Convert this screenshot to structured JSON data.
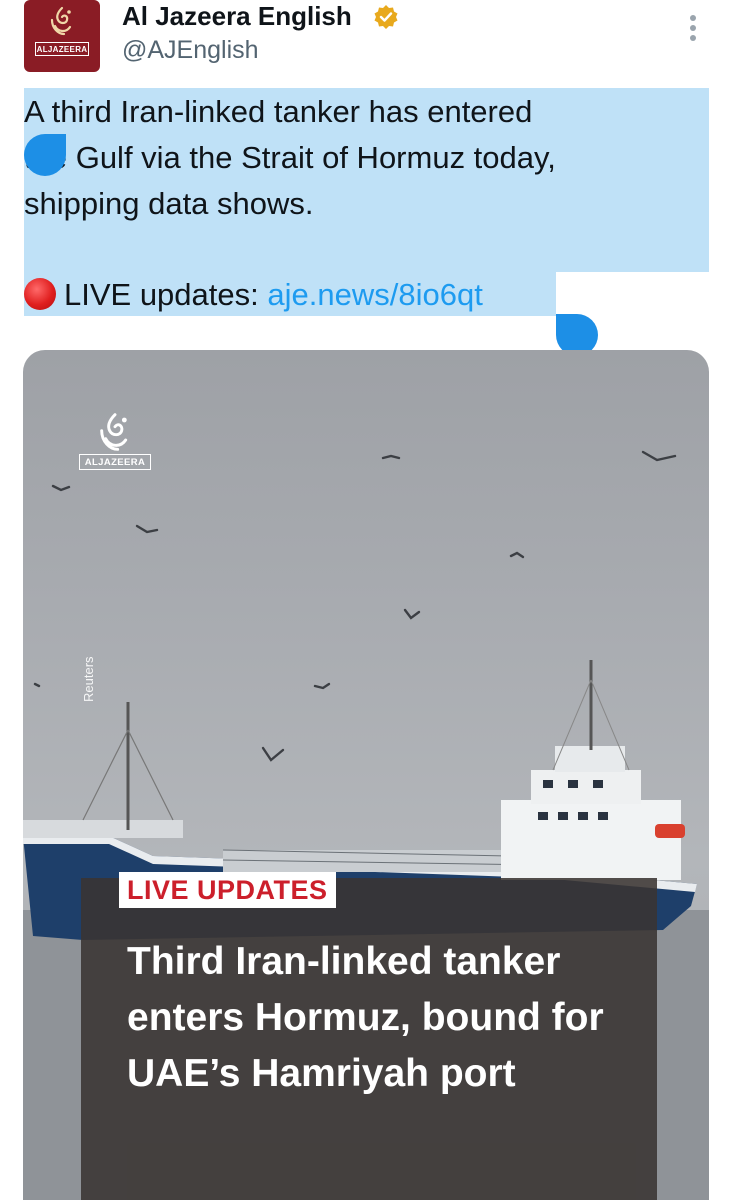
{
  "account": {
    "display_name": "Al Jazeera English",
    "handle": "@AJEnglish",
    "avatar_label": "ALJAZEERA",
    "verified_color": "#e8a91d"
  },
  "tweet": {
    "lines": [
      "A third Iran-linked tanker has entered",
      "the Gulf via the Strait of Hormuz today,",
      "shipping data shows."
    ],
    "live_prefix": "LIVE updates: ",
    "link": "aje.news/8io6qt"
  },
  "media": {
    "logo_label": "ALJAZEERA",
    "photo_credit": "Reuters",
    "badge": "LIVE UPDATES",
    "headline": "Third Iran-linked tanker enters Hormuz, bound for UAE’s Hamriyah port"
  },
  "colors": {
    "link": "#1d9bf0",
    "selection": "#bfe1f7",
    "selection_handle": "#1d8fe6",
    "badge_red": "#cc1f2b",
    "brand": "#8a1c25"
  }
}
